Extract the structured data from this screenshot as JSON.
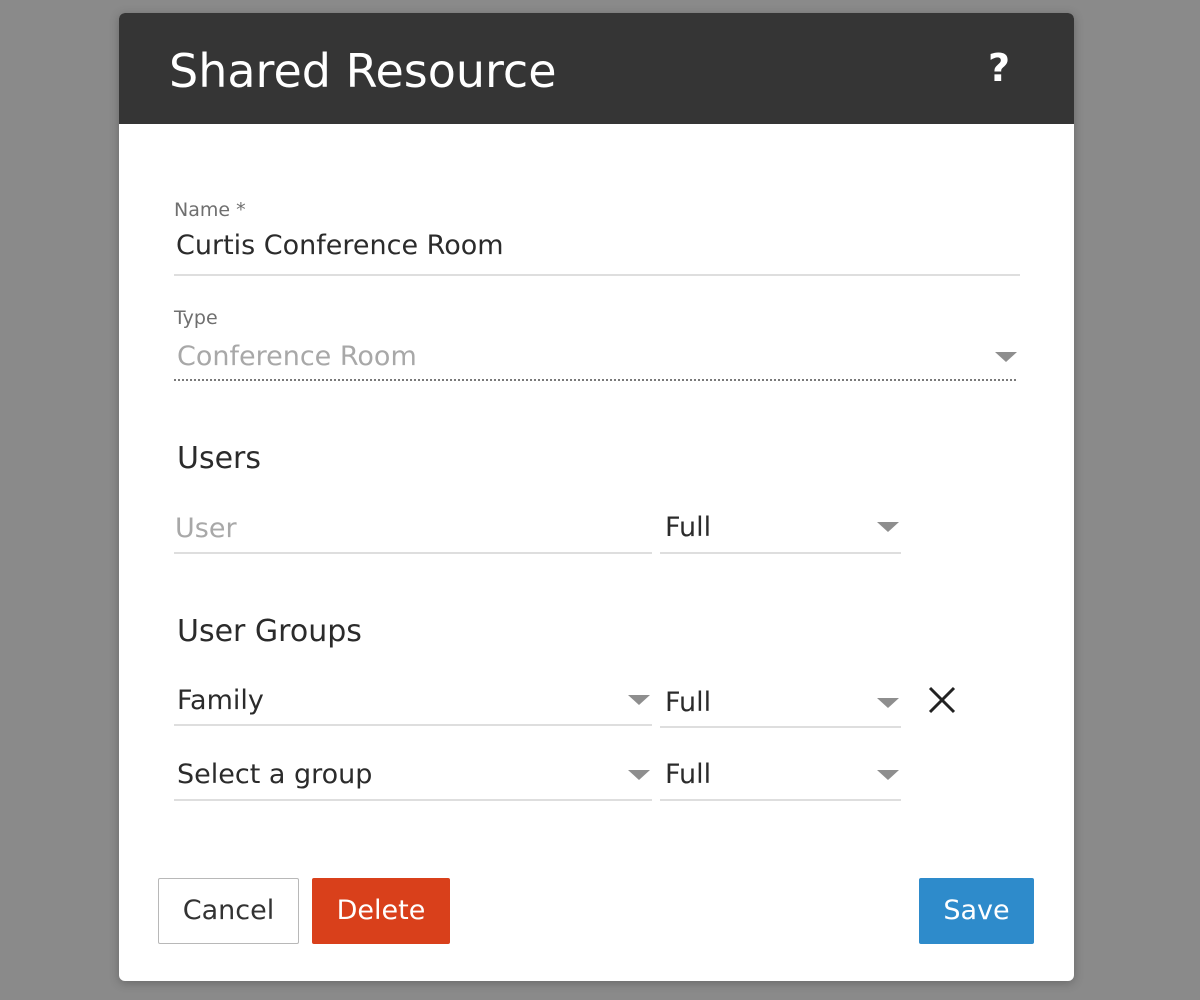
{
  "dialog": {
    "title": "Shared Resource",
    "help_label": "?"
  },
  "form": {
    "name": {
      "label": "Name *",
      "value": "Curtis Conference Room"
    },
    "type": {
      "label": "Type",
      "value": "Conference Room"
    }
  },
  "users": {
    "heading": "Users",
    "user_placeholder": "User",
    "permission": "Full"
  },
  "user_groups": {
    "heading": "User Groups",
    "rows": [
      {
        "group": "Family",
        "permission": "Full",
        "removable": true
      },
      {
        "group": "Select a group",
        "permission": "Full",
        "removable": false
      }
    ]
  },
  "buttons": {
    "cancel": "Cancel",
    "delete": "Delete",
    "save": "Save"
  },
  "colors": {
    "header_bg": "#353535",
    "delete_bg": "#d9401b",
    "save_bg": "#2e8bcb"
  },
  "icons": {
    "help": "help-icon",
    "dropdown": "chevron-down-icon",
    "remove": "close-icon"
  }
}
